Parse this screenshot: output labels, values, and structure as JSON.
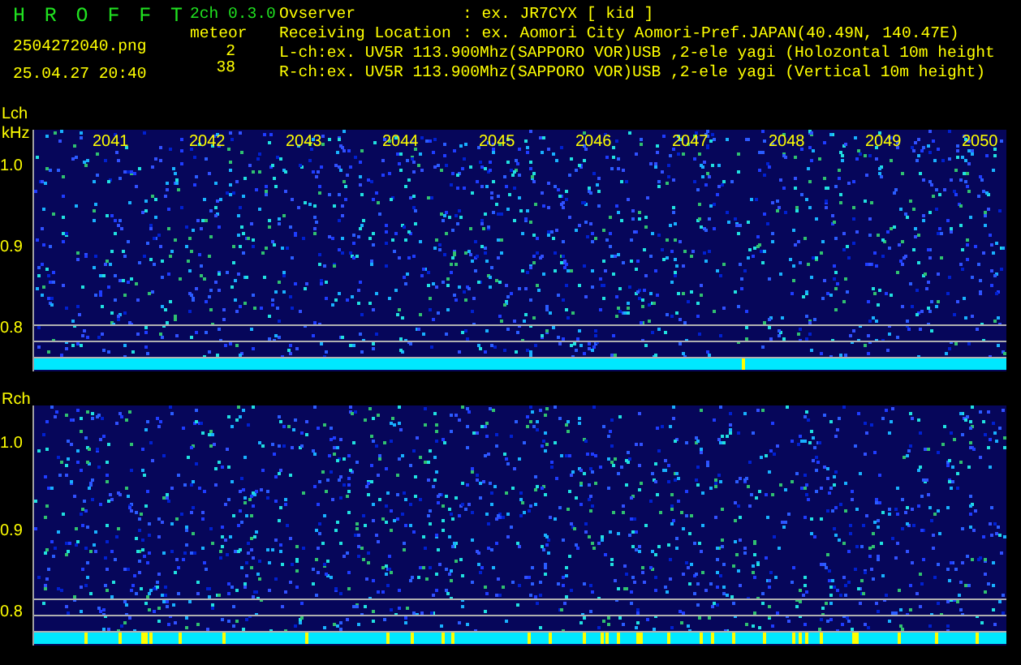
{
  "app": {
    "title": "H R O F F T",
    "version": "2ch 0.3.0"
  },
  "file": {
    "name": "2504272040.png",
    "datetime": "25.04.27 20:40"
  },
  "meteor": {
    "label": "meteor",
    "counts": [
      "2",
      "38"
    ]
  },
  "info": [
    {
      "label": "Ovserver",
      "value": ": ex. JR7CYX [ kid ]"
    },
    {
      "label": "Receiving Location",
      "value": ": ex. Aomori City Aomori-Pref.JAPAN(40.49N, 140.47E)"
    }
  ],
  "channel_lines": [
    "L-ch:ex. UV5R 113.900Mhz(SAPPORO VOR)USB ,2-ele yagi (Holozontal 10m height",
    "R-ch:ex. UV5R 113.900Mhz(SAPPORO VOR)USB ,2-ele yagi (Vertical 10m height)"
  ],
  "panels": [
    {
      "name": "Lch",
      "unit": "kHz",
      "time_labels": [
        "2041",
        "2042",
        "2043",
        "2044",
        "2045",
        "2046",
        "2047",
        "2048",
        "2049",
        "2050"
      ],
      "y_labels": [
        "1.0",
        "0.9",
        "0.8"
      ]
    },
    {
      "name": "Rch",
      "y_labels": [
        "1.0",
        "0.9",
        "0.8"
      ]
    }
  ]
}
